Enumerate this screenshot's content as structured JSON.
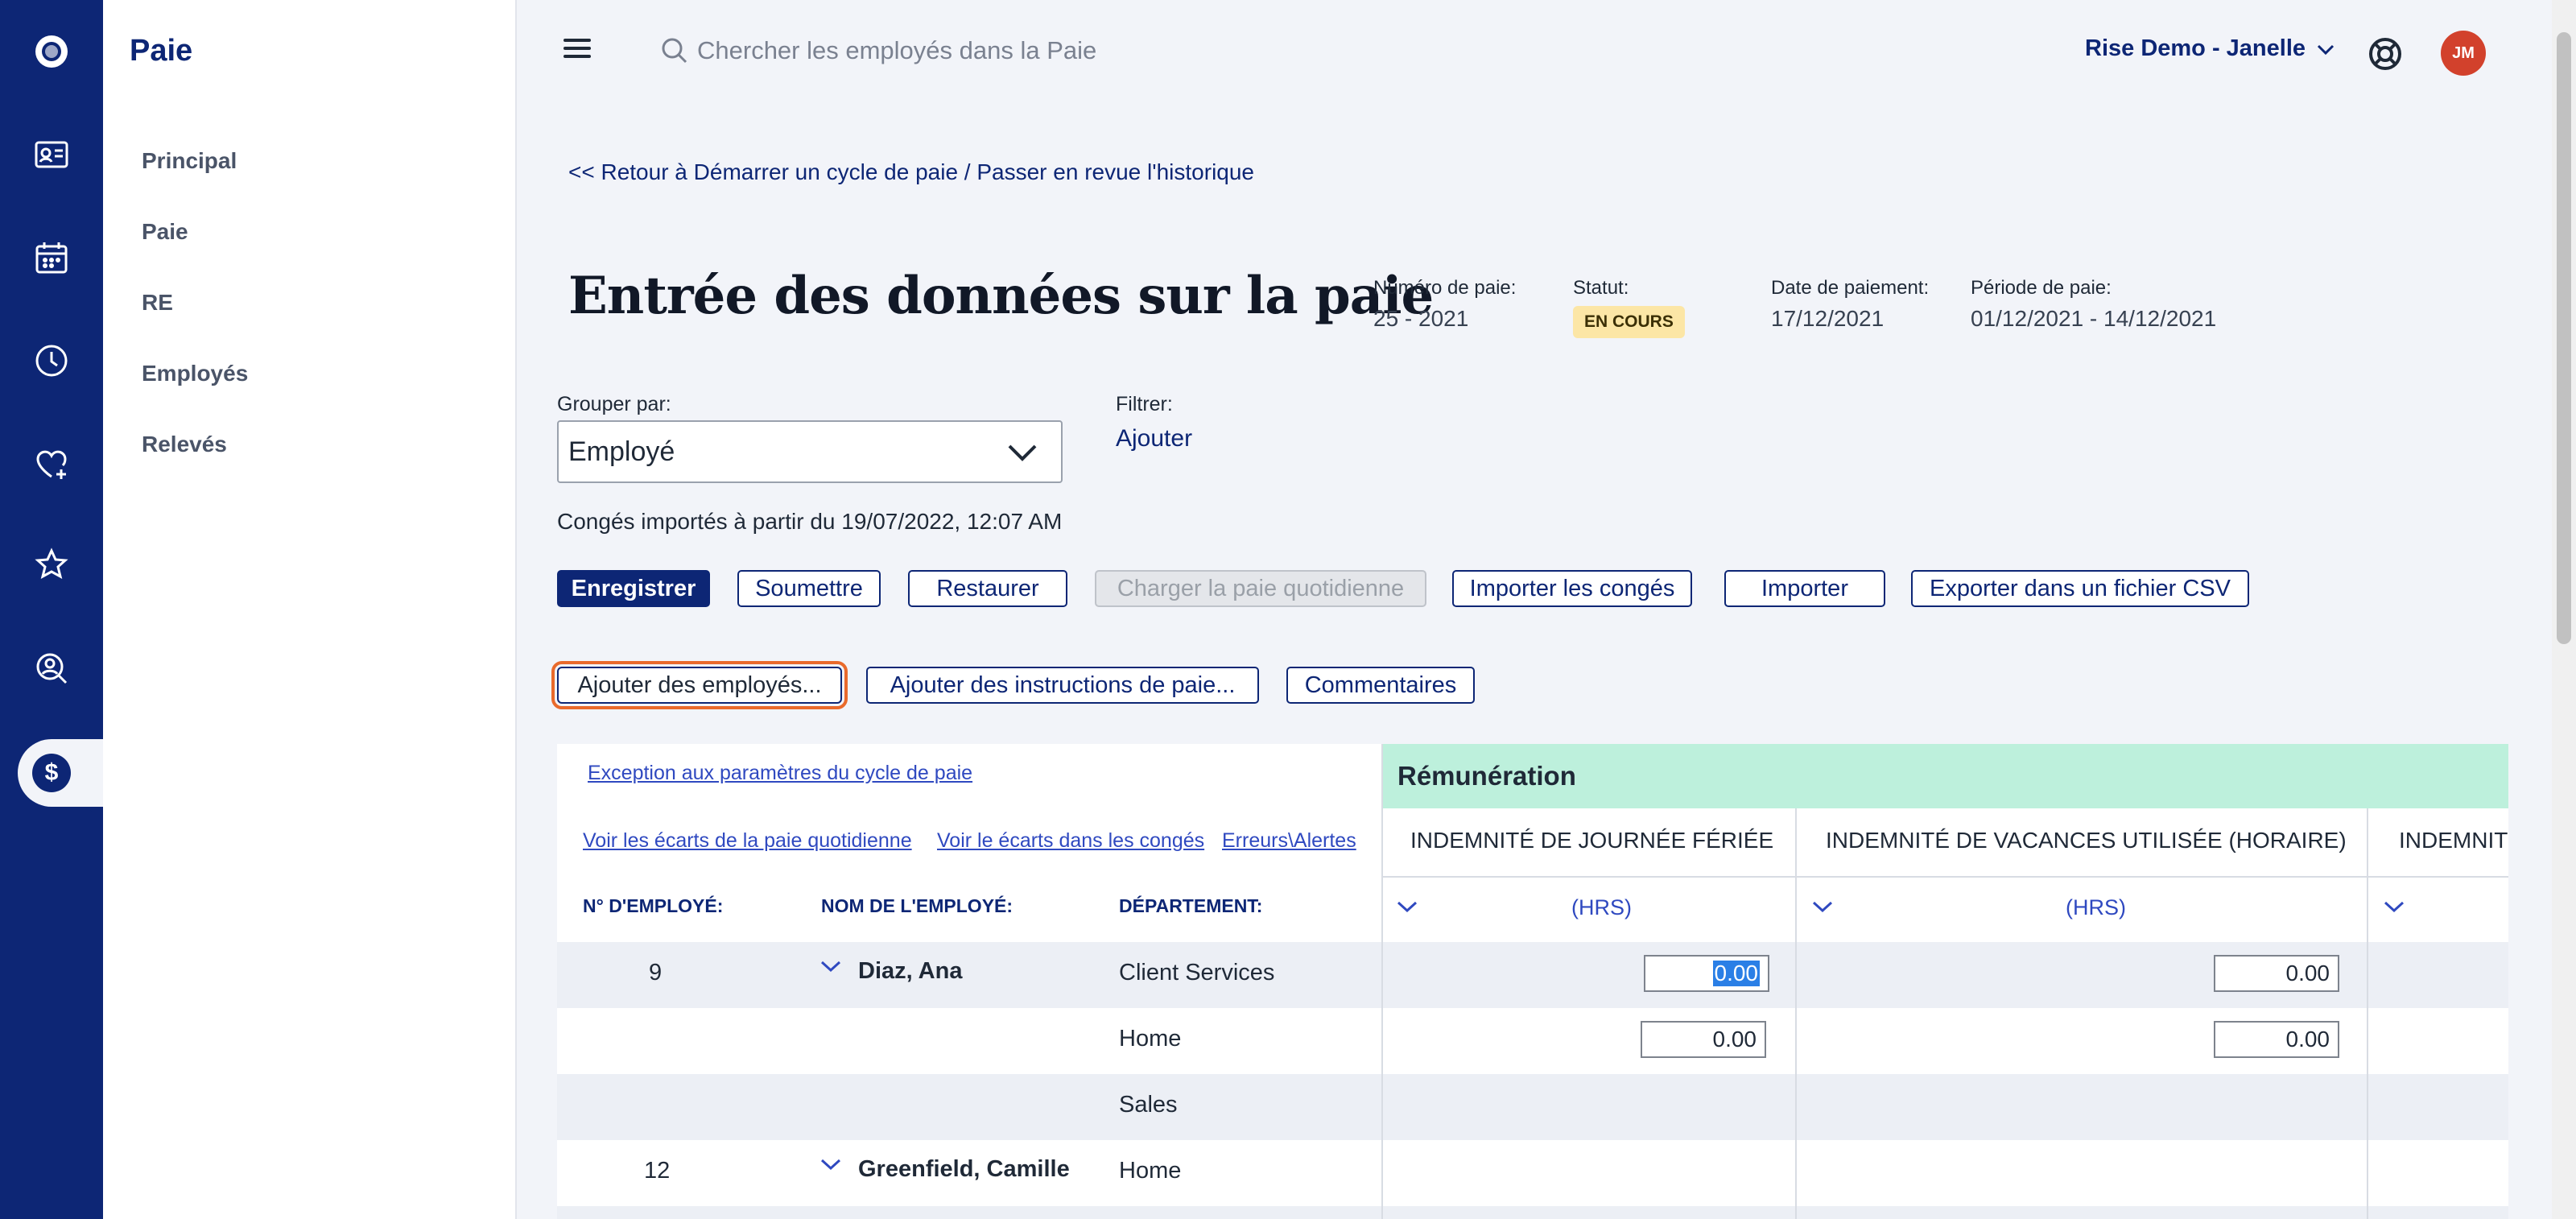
{
  "app": {
    "section_title": "Paie"
  },
  "rail_icons": [
    "logo-icon",
    "id-card-icon",
    "calendar-icon",
    "clock-icon",
    "heart-plus-icon",
    "star-badge-icon",
    "person-search-icon",
    "dollar-icon"
  ],
  "sidenav": {
    "title": "Paie",
    "items": [
      {
        "label": "Principal"
      },
      {
        "label": "Paie"
      },
      {
        "label": "RE"
      },
      {
        "label": "Employés"
      },
      {
        "label": "Relevés"
      }
    ]
  },
  "topbar": {
    "search_placeholder": "Chercher les employés dans la Paie",
    "account_label": "Rise Demo - Janelle",
    "avatar_initials": "JM"
  },
  "page": {
    "back_link": "<< Retour à Démarrer un cycle de paie / Passer en revue l'historique",
    "title": "Entrée des données sur la paie",
    "meta": {
      "pay_number_label": "Numéro de paie:",
      "pay_number_value": "25 - 2021",
      "status_label": "Statut:",
      "status_value": "EN COURS",
      "pay_date_label": "Date de paiement:",
      "pay_date_value": "17/12/2021",
      "pay_period_label": "Période de paie:",
      "pay_period_value": "01/12/2021 - 14/12/2021"
    },
    "group_by_label": "Grouper par:",
    "group_by_value": "Employé",
    "filter_label": "Filtrer:",
    "filter_add": "Ajouter",
    "import_note": "Congés importés à partir du 19/07/2022, 12:07 AM"
  },
  "toolbar": {
    "save": "Enregistrer",
    "submit": "Soumettre",
    "restore": "Restaurer",
    "load_daily": "Charger la paie quotidienne",
    "import_leave": "Importer les congés",
    "import": "Importer",
    "export_csv": "Exporter dans un fichier CSV",
    "add_employees": "Ajouter des employés...",
    "add_instructions": "Ajouter des instructions de paie...",
    "comments": "Commentaires"
  },
  "table": {
    "exception_link": "Exception aux paramètres du cycle de paie",
    "daily_gaps_link": "Voir les écarts de la paie quotidienne",
    "leave_gaps_link": "Voir le écarts dans les congés",
    "errors_link": "Erreurs\\Alertes",
    "col_emp_no": "N° D'EMPLOYÉ:",
    "col_emp_name": "NOM DE L'EMPLOYÉ:",
    "col_department": "DÉPARTEMENT:",
    "remuneration_header": "Rémunération",
    "remu_cols": [
      {
        "title": "INDEMNITÉ DE JOURNÉE FÉRIÉE",
        "unit": "(HRS)"
      },
      {
        "title": "INDEMNITÉ DE VACANCES UTILISÉE (HORAIRE)",
        "unit": "(HRS)"
      },
      {
        "title": "INDEMNIT",
        "unit": ""
      }
    ],
    "rows": [
      {
        "emp_no": "9",
        "name": "Diaz, Ana",
        "department": "Client Services",
        "v1": "0.00",
        "v2": "0.00"
      },
      {
        "emp_no": "",
        "name": "",
        "department": "Home",
        "v1": "0.00",
        "v2": "0.00"
      },
      {
        "emp_no": "",
        "name": "",
        "department": "Sales",
        "v1": "",
        "v2": ""
      },
      {
        "emp_no": "12",
        "name": "Greenfield, Camille",
        "department": "Home",
        "v1": "",
        "v2": ""
      }
    ]
  }
}
